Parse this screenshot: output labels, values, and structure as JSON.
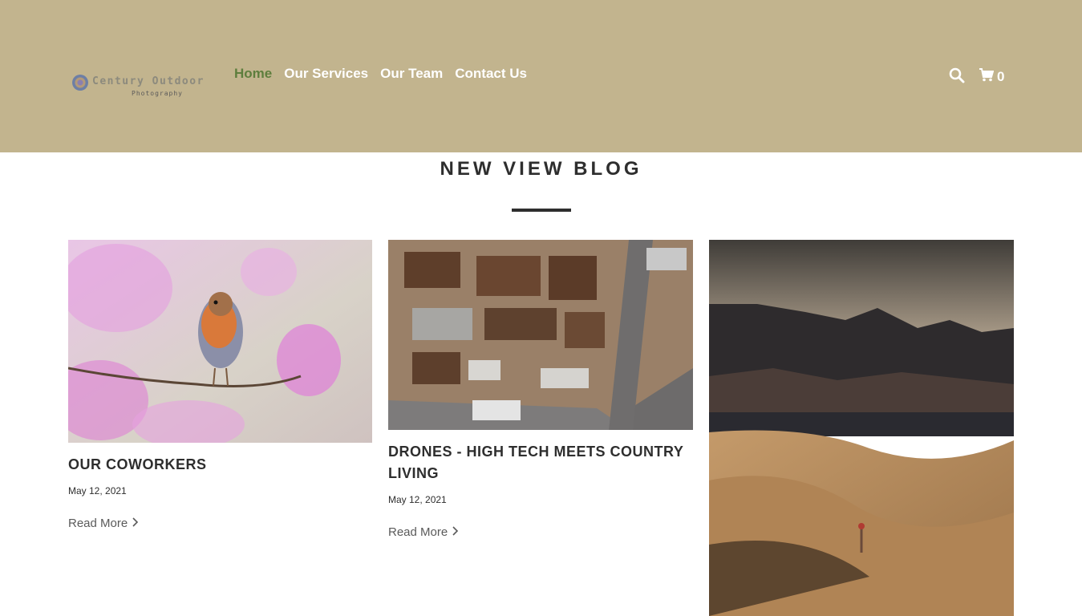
{
  "header": {
    "logo": {
      "title": "Century Outdoor",
      "subtitle": "Photography"
    },
    "nav": [
      {
        "label": "Home",
        "active": true
      },
      {
        "label": "Our Services"
      },
      {
        "label": "Our Team"
      },
      {
        "label": "Contact Us"
      }
    ],
    "cart_count": "0",
    "colors": {
      "background": "#c2b48e",
      "active_link": "#5e7e3d"
    }
  },
  "main": {
    "section_title": "NEW VIEW BLOG",
    "posts": [
      {
        "title": "OUR COWORKERS",
        "date": "May 12, 2021",
        "read_more": "Read More",
        "image": "robin-on-blossom-branch"
      },
      {
        "title": "DRONES - HIGH TECH MEETS COUNTRY LIVING",
        "date": "May 12, 2021",
        "read_more": "Read More",
        "image": "aerial-industrial-yard"
      },
      {
        "image": "desert-dunes-mountains"
      }
    ]
  }
}
